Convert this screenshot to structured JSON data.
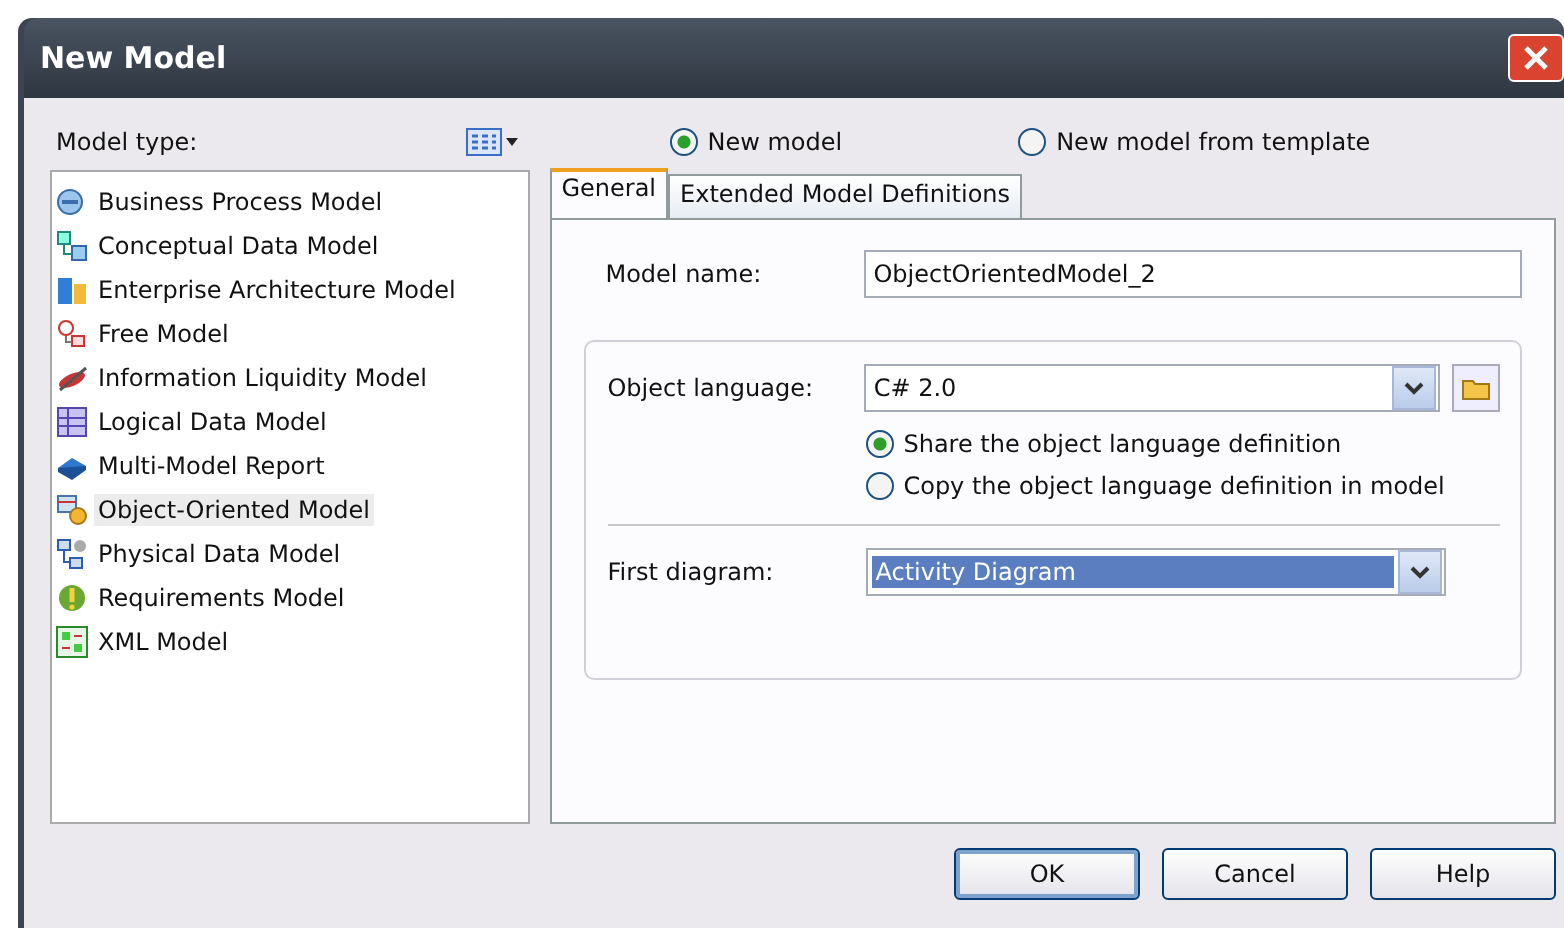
{
  "window": {
    "title": "New Model"
  },
  "model_type_label": "Model type:",
  "model_types": [
    {
      "label": "Business Process Model",
      "kind": "process",
      "selected": false
    },
    {
      "label": "Conceptual Data Model",
      "kind": "conceptual",
      "selected": false
    },
    {
      "label": "Enterprise Architecture Model",
      "kind": "enterprise",
      "selected": false
    },
    {
      "label": "Free Model",
      "kind": "free",
      "selected": false
    },
    {
      "label": "Information Liquidity Model",
      "kind": "liquidity",
      "selected": false
    },
    {
      "label": "Logical Data Model",
      "kind": "logical",
      "selected": false
    },
    {
      "label": "Multi-Model Report",
      "kind": "report",
      "selected": false
    },
    {
      "label": "Object-Oriented Model",
      "kind": "oo",
      "selected": true
    },
    {
      "label": "Physical Data Model",
      "kind": "physical",
      "selected": false
    },
    {
      "label": "Requirements Model",
      "kind": "requirements",
      "selected": false
    },
    {
      "label": "XML Model",
      "kind": "xml",
      "selected": false
    }
  ],
  "mode_options": [
    {
      "label": "New model",
      "selected": true
    },
    {
      "label": "New model from template",
      "selected": false
    }
  ],
  "tabs": [
    {
      "label": "General",
      "selected": true
    },
    {
      "label": "Extended Model Definitions",
      "selected": false
    }
  ],
  "model_name": {
    "label": "Model name:",
    "value": "ObjectOrientedModel_2"
  },
  "object_language": {
    "label": "Object language:",
    "value": "C# 2.0"
  },
  "language_options": [
    {
      "label": "Share the object language definition",
      "selected": true
    },
    {
      "label": "Copy the object language definition in model",
      "selected": false
    }
  ],
  "first_diagram": {
    "label": "First diagram:",
    "value": "Activity Diagram"
  },
  "buttons": [
    {
      "label": "OK",
      "default": true
    },
    {
      "label": "Cancel",
      "default": false
    },
    {
      "label": "Help",
      "default": false
    }
  ]
}
